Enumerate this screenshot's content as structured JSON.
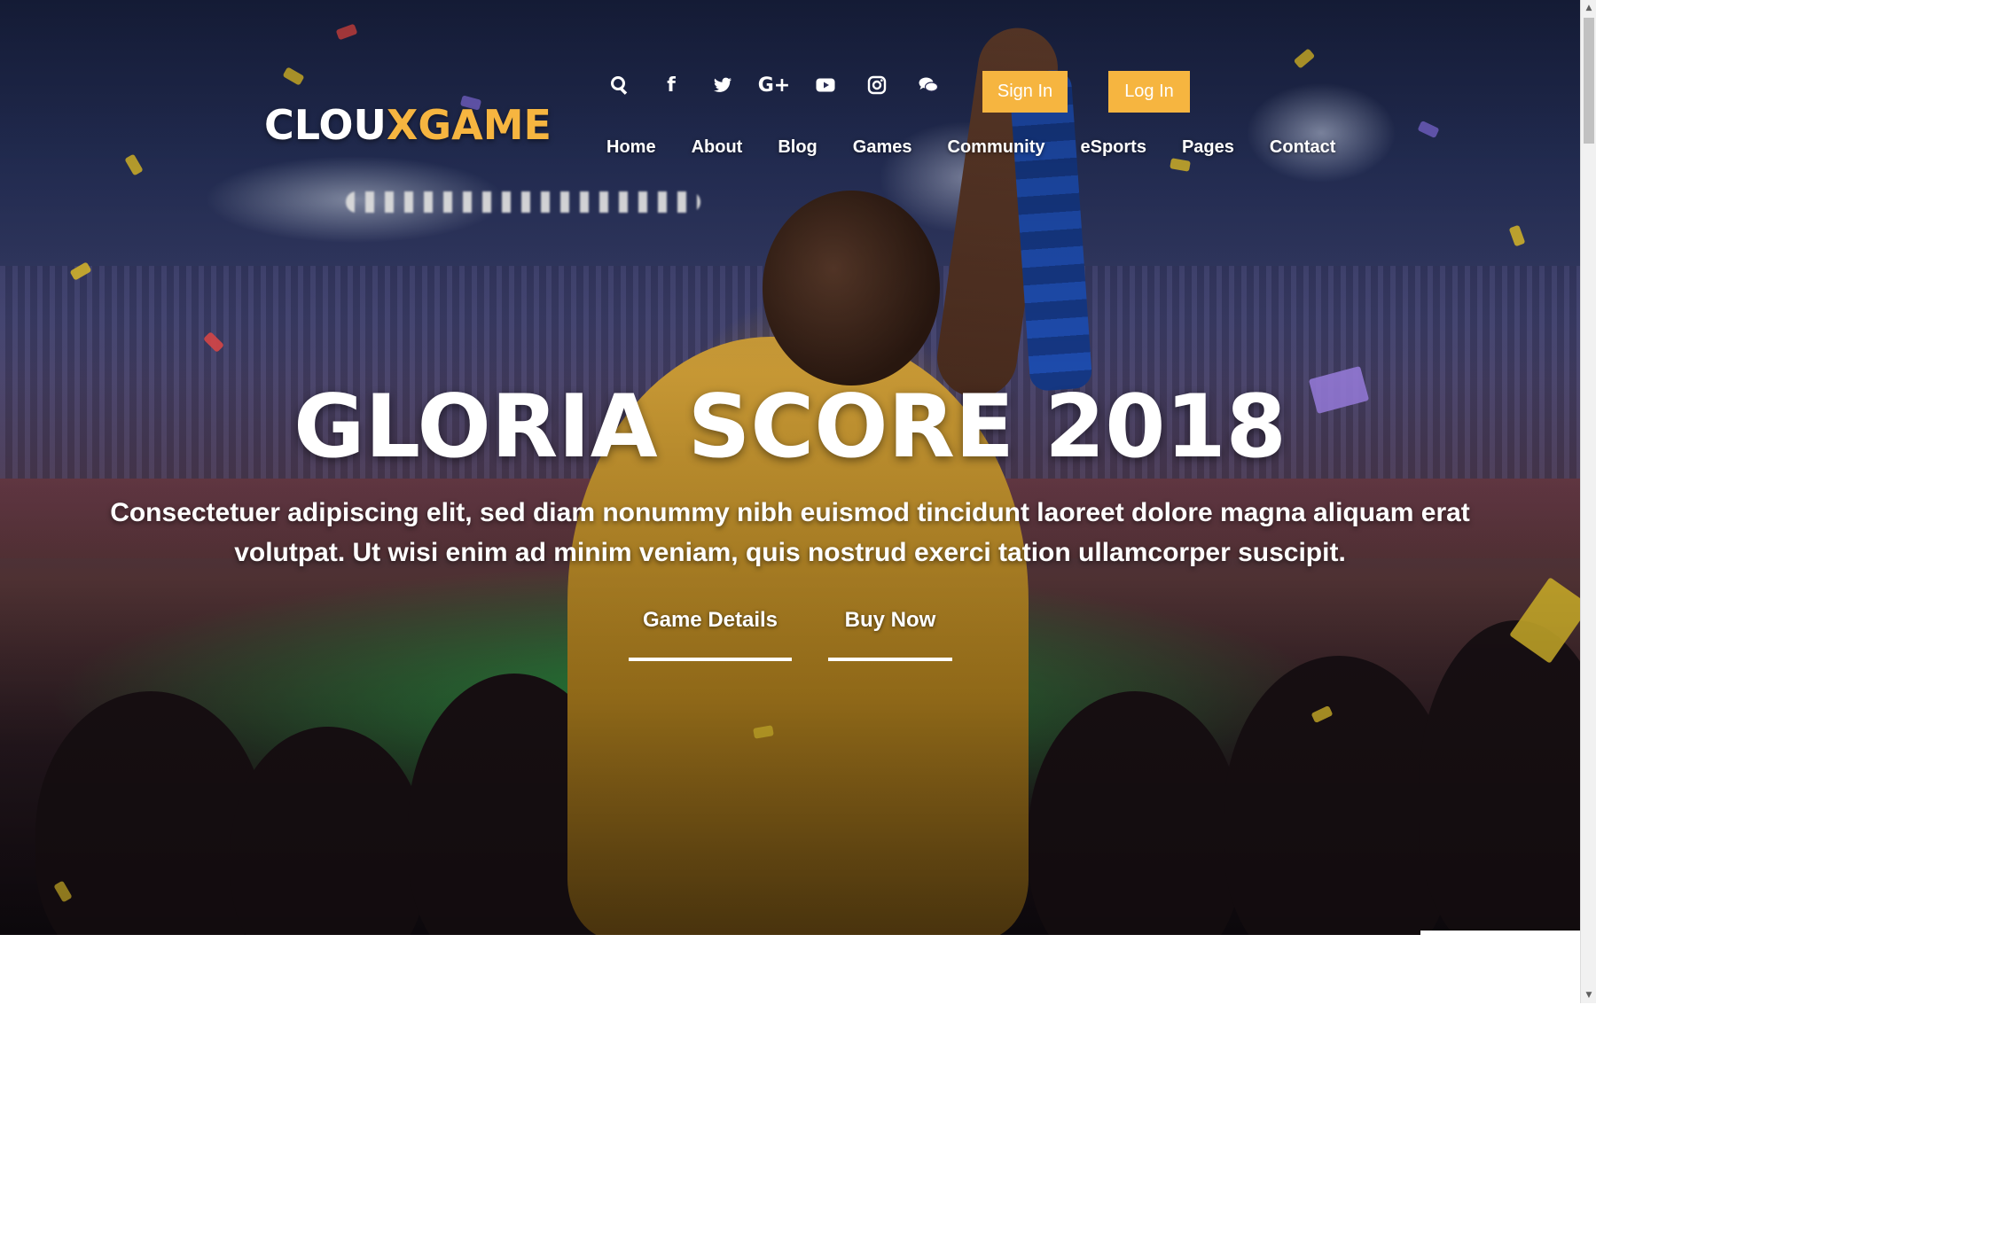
{
  "brand": {
    "logo_part1": "CLOU",
    "logo_part2": "XGAME",
    "accent_color": "#f6b540"
  },
  "social_icons": [
    {
      "name": "search-icon"
    },
    {
      "name": "facebook-icon",
      "glyph": "f"
    },
    {
      "name": "twitter-icon"
    },
    {
      "name": "google-plus-icon",
      "glyph": "G+"
    },
    {
      "name": "youtube-icon"
    },
    {
      "name": "instagram-icon"
    },
    {
      "name": "chat-icon"
    }
  ],
  "auth": {
    "signin_label": "Sign In",
    "login_label": "Log In"
  },
  "nav": {
    "items": [
      "Home",
      "About",
      "Blog",
      "Games",
      "Community",
      "eSports",
      "Pages",
      "Contact"
    ]
  },
  "hero": {
    "title": "GLORIA SCORE 2018",
    "subtitle": "Consectetuer adipiscing elit, sed diam nonummy nibh euismod tincidunt laoreet dolore magna aliquam erat volutpat. Ut wisi enim ad minim veniam, quis nostrud exerci tation ullamcorper suscipit.",
    "cta_details": "Game Details",
    "cta_buy": "Buy Now"
  },
  "scrollbar": {
    "up_glyph": "▲",
    "down_glyph": "▼"
  }
}
